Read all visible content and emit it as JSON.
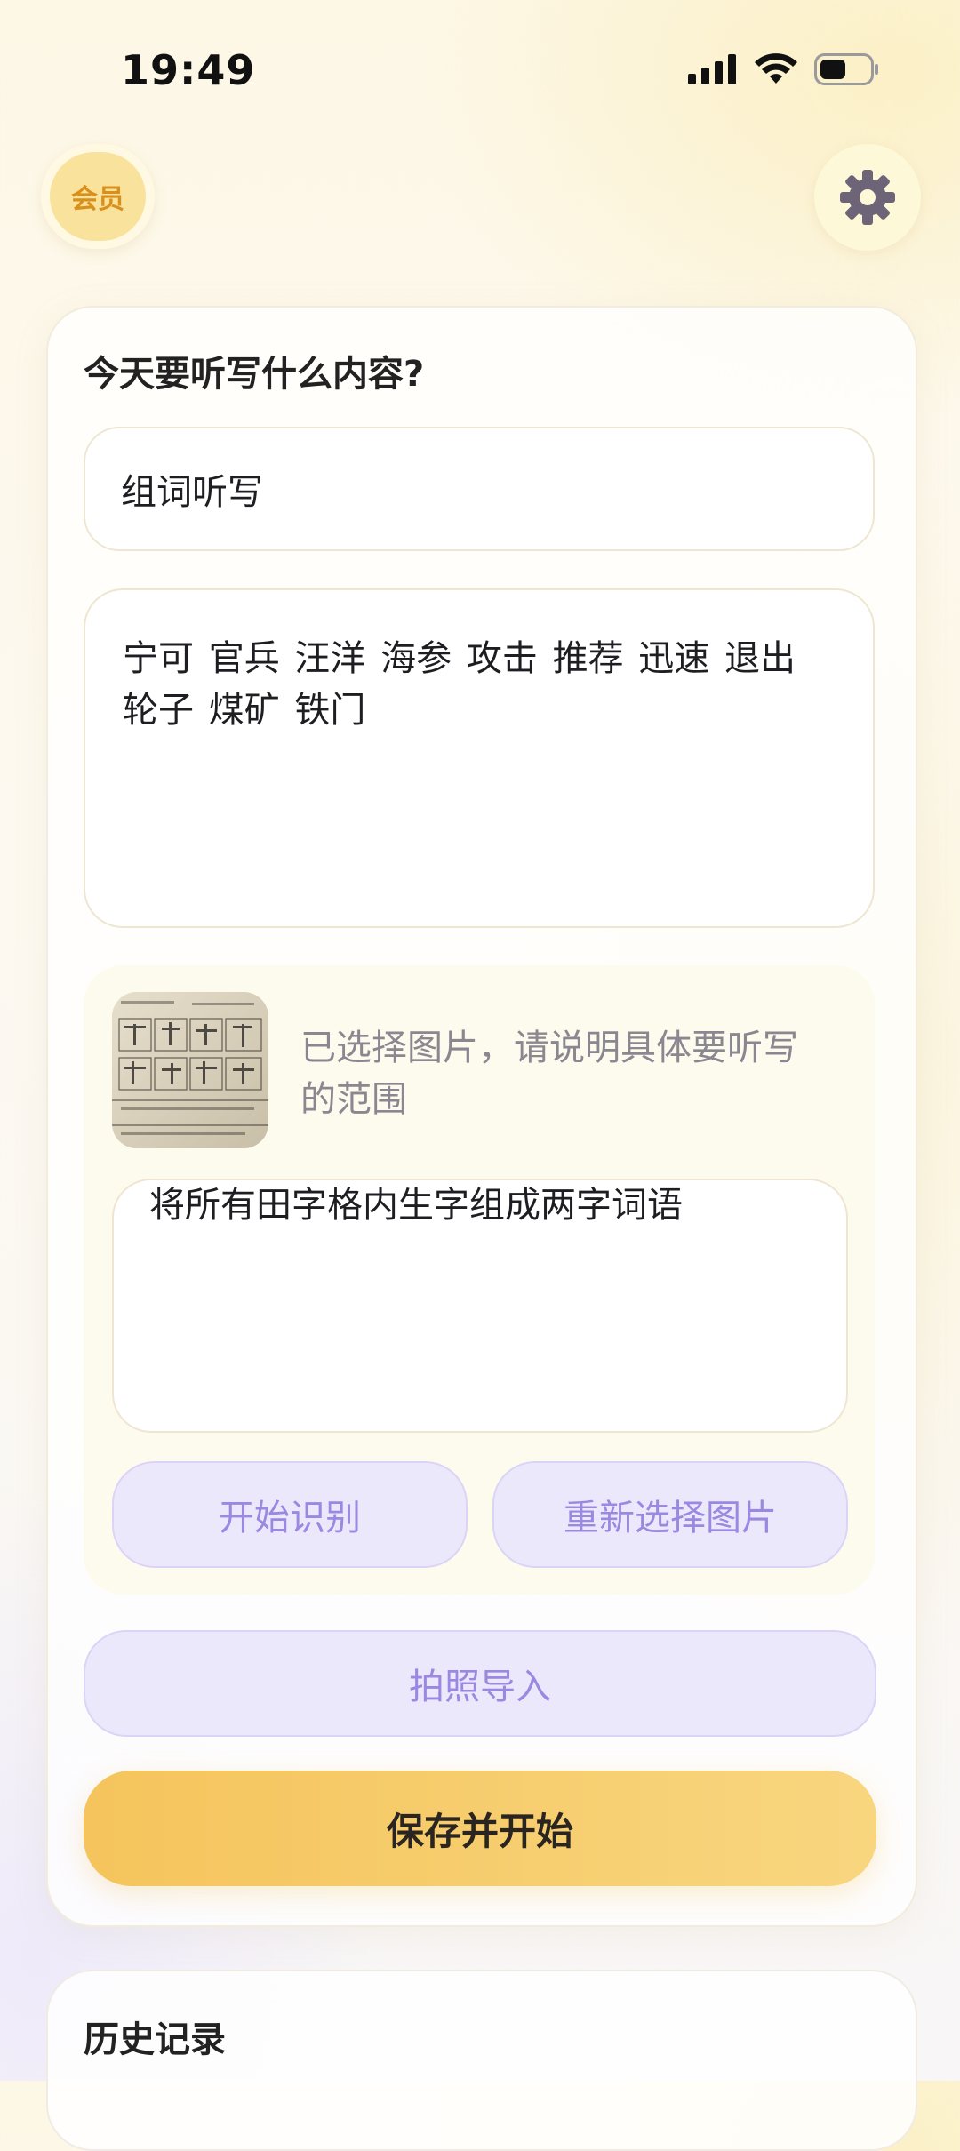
{
  "status_bar": {
    "time": "19:49",
    "icons": [
      "cellular-signal-icon",
      "wifi-icon",
      "battery-icon"
    ]
  },
  "header": {
    "member_label": "会员",
    "settings_icon": "gear-icon"
  },
  "main": {
    "title": "今天要听写什么内容?",
    "mode_value": "组词听写",
    "words_value": "宁可 官兵 汪洋 海参 攻击 推荐 迅速 退出 轮子 煤矿 铁门",
    "image_section": {
      "thumbnail": "dictation-worksheet-photo",
      "hint": "已选择图片，请说明具体要听写的范围",
      "scope_value": "将所有田字格内生字组成两字词语",
      "recognize_button": "开始识别",
      "reselect_button": "重新选择图片"
    },
    "photo_import_button": "拍照导入",
    "save_start_button": "保存并开始"
  },
  "history": {
    "title": "历史记录"
  },
  "colors": {
    "accent_gold": "#f5c45c",
    "purple_text": "#9b88e0",
    "purple_bg": "#ece8fb",
    "member_text": "#d98f1c",
    "gear": "#6d6478"
  }
}
